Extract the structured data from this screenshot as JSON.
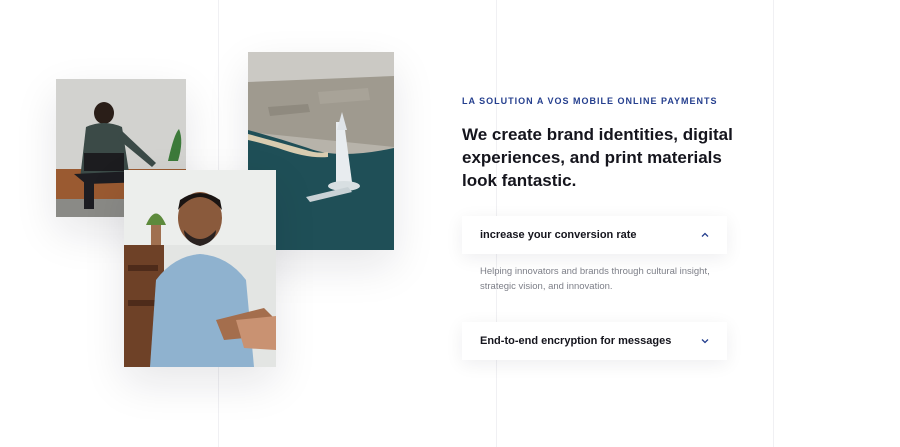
{
  "hero": {
    "eyebrow": "LA SOLUTION A VOS MOBILE ONLINE PAYMENTS",
    "headline": "We create brand identities, digital experiences, and print materials look fantastic."
  },
  "accordion": {
    "items": [
      {
        "title": "increase your conversion rate",
        "expanded": true,
        "icon": "chevron-up-icon",
        "body": "Helping innovators and brands through cultural insight, strategic vision, and innovation."
      },
      {
        "title": "End-to-end encryption for messages",
        "expanded": false,
        "icon": "chevron-down-icon",
        "body": ""
      }
    ]
  },
  "colors": {
    "accent": "#253f8e",
    "heading": "#15151d",
    "body_text": "#7d7f88",
    "grid_line": "#f0f0f3"
  }
}
